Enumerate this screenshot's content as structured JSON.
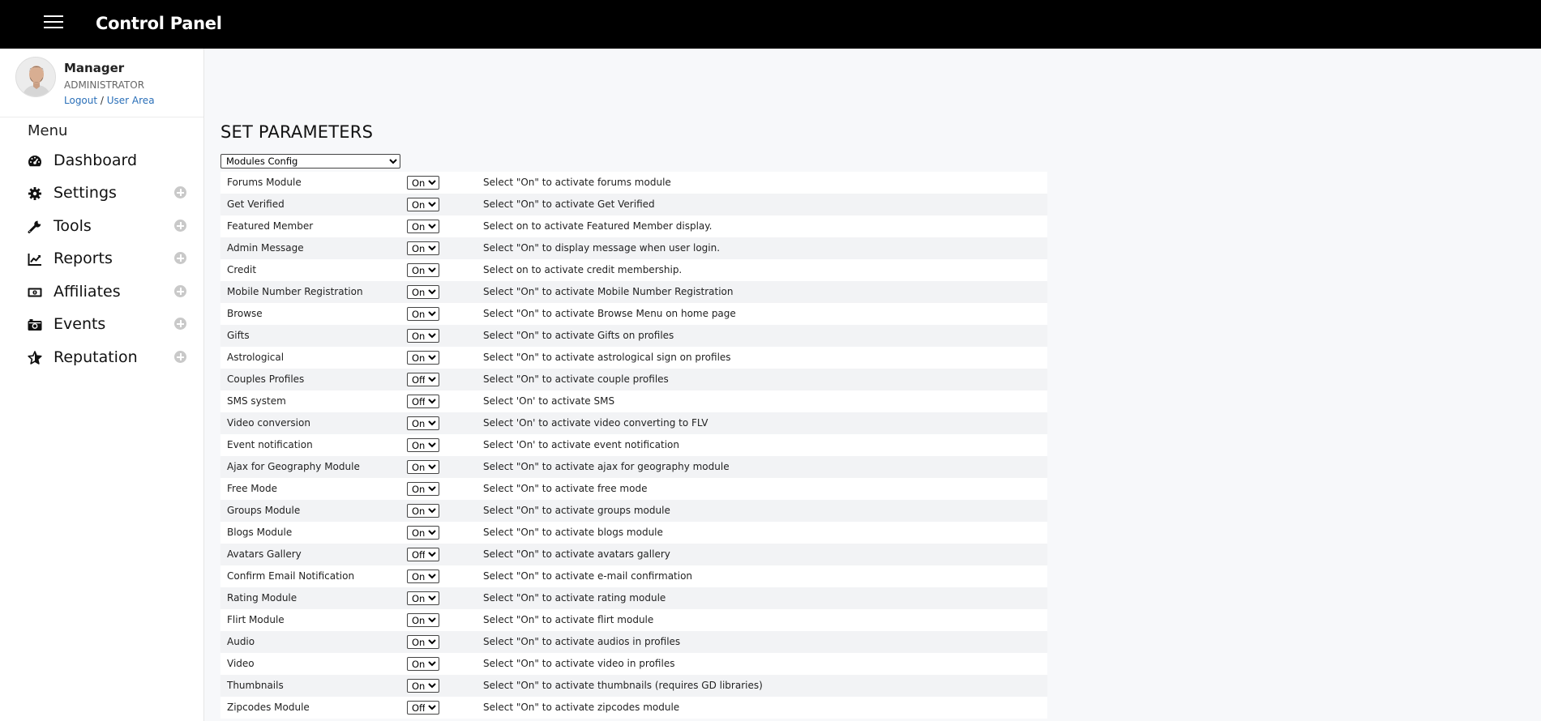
{
  "header": {
    "title": "Control Panel"
  },
  "profile": {
    "name": "Manager",
    "role": "ADMINISTRATOR",
    "logout": "Logout",
    "separator": " / ",
    "user_area": "User Area"
  },
  "menu": {
    "heading": "Menu",
    "items": [
      {
        "label": "Dashboard",
        "icon": "dashboard-icon",
        "expandable": false
      },
      {
        "label": "Settings",
        "icon": "gear-icon",
        "expandable": true
      },
      {
        "label": "Tools",
        "icon": "wrench-icon",
        "expandable": true
      },
      {
        "label": "Reports",
        "icon": "chart-line-icon",
        "expandable": true
      },
      {
        "label": "Affiliates",
        "icon": "money-bill-icon",
        "expandable": true
      },
      {
        "label": "Events",
        "icon": "camera-icon",
        "expandable": true
      },
      {
        "label": "Reputation",
        "icon": "star-icon",
        "expandable": true
      }
    ]
  },
  "main": {
    "title": "SET PARAMETERS",
    "section_select": {
      "value": "Modules Config"
    },
    "params": [
      {
        "label": "Forums Module",
        "value": "On",
        "desc": "Select \"On\" to activate forums module"
      },
      {
        "label": "Get Verified",
        "value": "On",
        "desc": "Select \"On\" to activate Get Verified"
      },
      {
        "label": "Featured Member",
        "value": "On",
        "desc": "Select on to activate Featured Member display."
      },
      {
        "label": "Admin Message",
        "value": "On",
        "desc": "Select \"On\" to display message when user login."
      },
      {
        "label": "Credit",
        "value": "On",
        "desc": "Select on to activate credit membership."
      },
      {
        "label": "Mobile Number Registration",
        "value": "On",
        "desc": "Select \"On\" to activate Mobile Number Registration"
      },
      {
        "label": "Browse",
        "value": "On",
        "desc": "Select \"On\" to activate Browse Menu on home page"
      },
      {
        "label": "Gifts",
        "value": "On",
        "desc": "Select \"On\" to activate Gifts on profiles"
      },
      {
        "label": "Astrological",
        "value": "On",
        "desc": "Select \"On\" to activate astrological sign on profiles"
      },
      {
        "label": "Couples Profiles",
        "value": "Off",
        "desc": "Select \"On\" to activate couple profiles"
      },
      {
        "label": "SMS system",
        "value": "Off",
        "desc": "Select 'On' to activate SMS"
      },
      {
        "label": "Video conversion",
        "value": "On",
        "desc": "Select 'On' to activate video converting to FLV"
      },
      {
        "label": "Event notification",
        "value": "On",
        "desc": "Select 'On' to activate event notification"
      },
      {
        "label": "Ajax for Geography Module",
        "value": "On",
        "desc": "Select \"On\" to activate ajax for geography module"
      },
      {
        "label": "Free Mode",
        "value": "On",
        "desc": "Select \"On\" to activate free mode"
      },
      {
        "label": "Groups Module",
        "value": "On",
        "desc": "Select \"On\" to activate groups module"
      },
      {
        "label": "Blogs Module",
        "value": "On",
        "desc": "Select \"On\" to activate blogs module"
      },
      {
        "label": "Avatars Gallery",
        "value": "Off",
        "desc": "Select \"On\" to activate avatars gallery"
      },
      {
        "label": "Confirm Email Notification",
        "value": "On",
        "desc": "Select \"On\" to activate e-mail confirmation"
      },
      {
        "label": "Rating Module",
        "value": "On",
        "desc": "Select \"On\" to activate rating module"
      },
      {
        "label": "Flirt Module",
        "value": "On",
        "desc": "Select \"On\" to activate flirt module"
      },
      {
        "label": "Audio",
        "value": "On",
        "desc": "Select \"On\" to activate audios in profiles"
      },
      {
        "label": "Video",
        "value": "On",
        "desc": "Select \"On\" to activate video in profiles"
      },
      {
        "label": "Thumbnails",
        "value": "On",
        "desc": "Select \"On\" to activate thumbnails (requires GD libraries)"
      },
      {
        "label": "Zipcodes Module",
        "value": "Off",
        "desc": "Select \"On\" to activate zipcodes module"
      }
    ]
  }
}
